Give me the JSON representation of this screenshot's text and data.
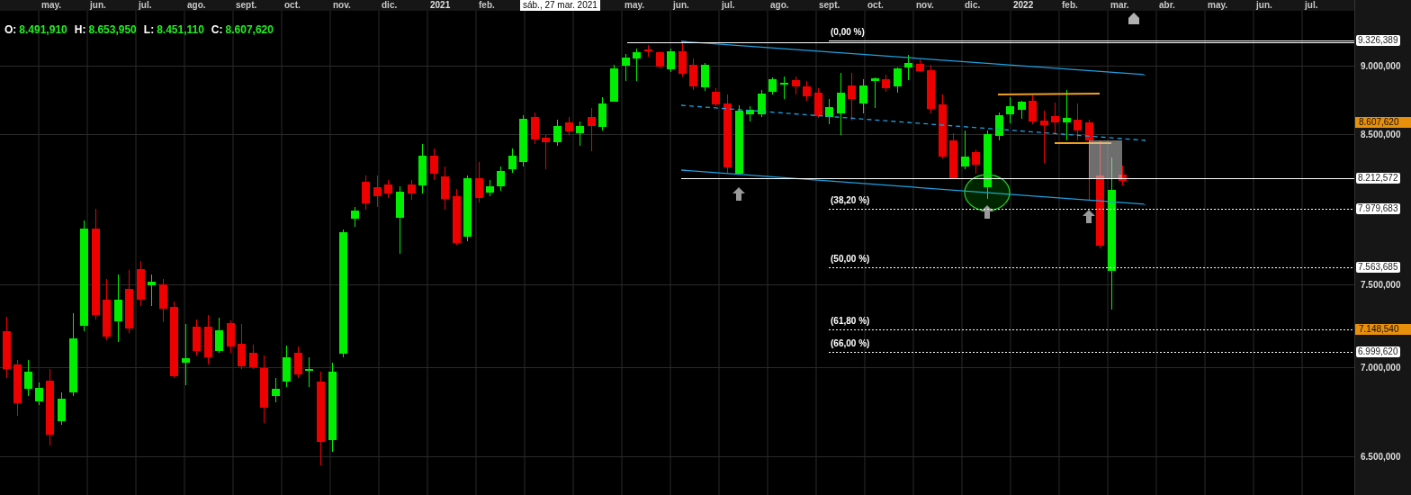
{
  "x_axis": {
    "labels": [
      {
        "kind": "month",
        "text": "may."
      },
      {
        "kind": "month",
        "text": "jun."
      },
      {
        "kind": "month",
        "text": "jul."
      },
      {
        "kind": "month",
        "text": "ago."
      },
      {
        "kind": "month",
        "text": "sept."
      },
      {
        "kind": "month",
        "text": "oct."
      },
      {
        "kind": "month",
        "text": "nov."
      },
      {
        "kind": "month",
        "text": "dic."
      },
      {
        "kind": "year",
        "text": "2021"
      },
      {
        "kind": "month",
        "text": "feb."
      },
      {
        "kind": "tooltip",
        "text": "sáb., 27 mar. 2021"
      },
      {
        "kind": "month",
        "text": "may."
      },
      {
        "kind": "month",
        "text": "jun."
      },
      {
        "kind": "month",
        "text": "jul."
      },
      {
        "kind": "month",
        "text": "ago."
      },
      {
        "kind": "month",
        "text": "sept."
      },
      {
        "kind": "month",
        "text": "oct."
      },
      {
        "kind": "month",
        "text": "nov."
      },
      {
        "kind": "month",
        "text": "dic."
      },
      {
        "kind": "year",
        "text": "2022"
      },
      {
        "kind": "month",
        "text": "feb."
      },
      {
        "kind": "month",
        "text": "mar."
      },
      {
        "kind": "month",
        "text": "abr."
      },
      {
        "kind": "month",
        "text": "may."
      },
      {
        "kind": "month",
        "text": "jun."
      },
      {
        "kind": "month",
        "text": "jul."
      }
    ]
  },
  "ohlc": [
    {
      "label": "O:",
      "value": "8.491,910"
    },
    {
      "label": "H:",
      "value": "8.653,950"
    },
    {
      "label": "L:",
      "value": "8.451,110"
    },
    {
      "label": "C:",
      "value": "8.607,620"
    }
  ],
  "fib_levels": [
    {
      "label": "(0,00 %)",
      "tag": "9.326,389",
      "highlighted": false
    },
    {
      "label": "(38,20 %)",
      "tag": "7.979,683",
      "highlighted": false
    },
    {
      "label": "(50,00 %)",
      "tag": "7.563,685",
      "highlighted": false
    },
    {
      "label": "(61,80 %)",
      "tag": "7.148,540",
      "highlighted": true
    },
    {
      "label": "(66,00 %)",
      "tag": "6.999,620",
      "highlighted": false
    }
  ],
  "price_tags": [
    {
      "kind": "last_price",
      "text": "8.607,620"
    },
    {
      "kind": "horizontal_line",
      "text": "8.212,572"
    }
  ],
  "y_axis": {
    "ticks": [
      "9.000,000",
      "8.500,000",
      "7.500,000",
      "7.000,000",
      "6.500,000"
    ]
  }
}
